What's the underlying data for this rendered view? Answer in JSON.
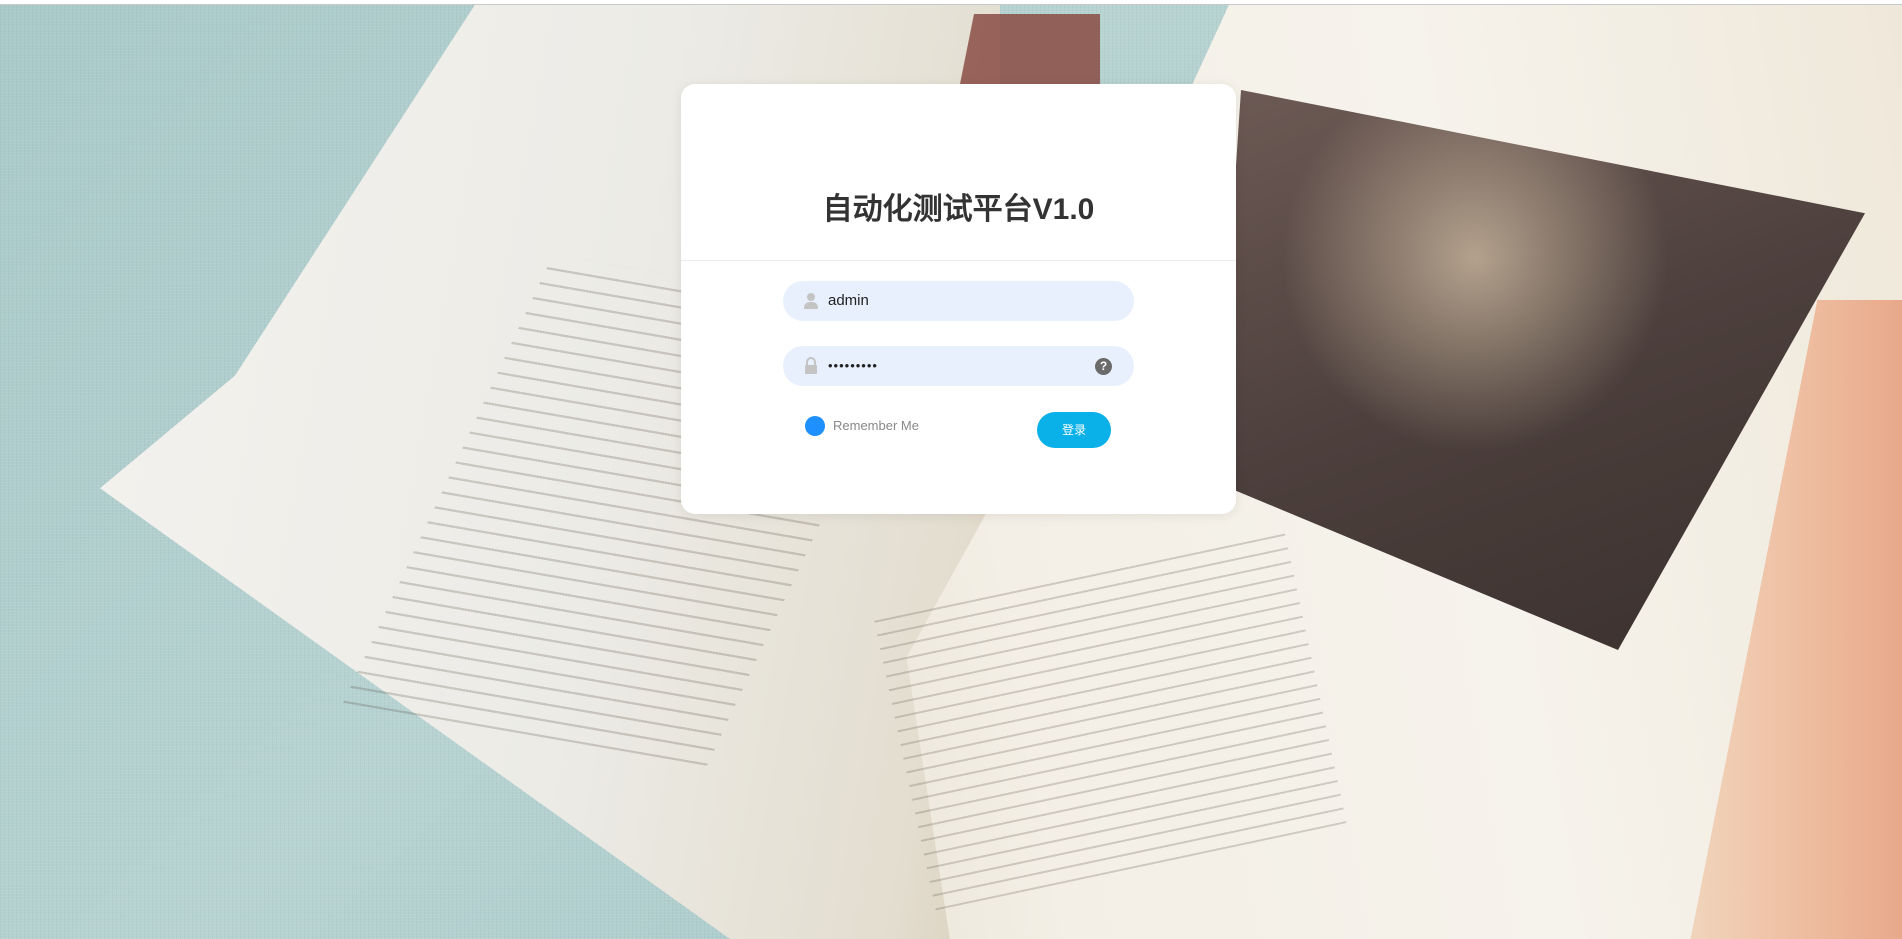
{
  "login": {
    "title": "自动化测试平台V1.0",
    "username": {
      "icon": "user-icon",
      "value": "admin"
    },
    "password": {
      "icon": "lock-icon",
      "masked_value": "•••••••••",
      "help_icon": "question-circle-icon",
      "help_glyph": "?"
    },
    "remember_me": {
      "label": "Remember Me",
      "checked": true
    },
    "submit_label": "登录"
  },
  "colors": {
    "accent": "#0ab0e8",
    "radio": "#1e90ff",
    "input_bg": "#e8f0fe",
    "title": "#333333"
  }
}
